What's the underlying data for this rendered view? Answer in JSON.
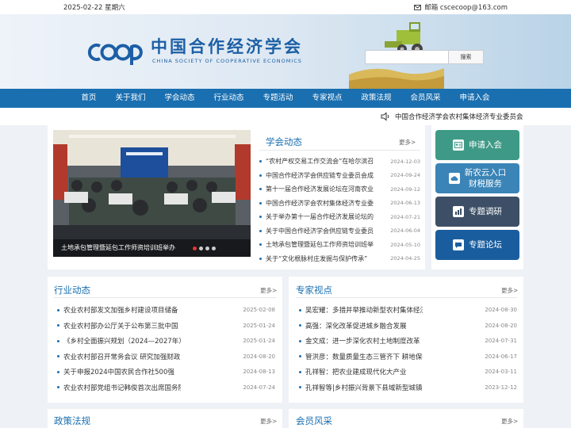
{
  "topbar": {
    "date": "2025-02-22 星期六",
    "email_label": "邮箱 cscecoop@163.com"
  },
  "banner": {
    "logo_text": "COOP",
    "title_cn": "中国合作经济学会",
    "title_en": "CHINA SOCIETY OF COOPERATIVE ECONOMICS",
    "search_placeholder": "",
    "search_button": "搜索"
  },
  "nav": [
    "首页",
    "关于我们",
    "学会动态",
    "行业动态",
    "专题活动",
    "专家视点",
    "政策法规",
    "会员风采",
    "申请入会"
  ],
  "notice": {
    "text": "中国合作经济学会农村集体经济专业委员会关于举办第十届合作经济发展论坛的通知"
  },
  "slide": {
    "caption": "土地承包管理暨延包工作师资培训班举办",
    "dots": 4
  },
  "society_news": {
    "title": "学会动态",
    "more": "更多>",
    "items": [
      {
        "title": "“农村产权交易工作交流会”在哈尔滨召开",
        "date": "2024-12-03"
      },
      {
        "title": "中国合作经济学会供应链专业委员会成立",
        "date": "2024-09-24"
      },
      {
        "title": "第十一届合作经济发展论坛在河南农业大学召开",
        "date": "2024-09-12"
      },
      {
        "title": "中国合作经济学会农村集体经济专业委员会",
        "date": "2024-06-13"
      },
      {
        "title": "关于举办第十一届合作经济发展论坛的通知",
        "date": "2024-07-21"
      },
      {
        "title": "关于中国合作经济学会供应链专业委员会",
        "date": "2024-06-04"
      },
      {
        "title": "土地承包管理暨延包工作师资培训班举办",
        "date": "2024-05-10"
      },
      {
        "title": "关于“文化根脉村庄发掘与保护传承”",
        "date": "2024-04-25"
      }
    ]
  },
  "tiles": [
    {
      "label": "申请入会",
      "color": "#3e9a87",
      "icon": "id-card-icon"
    },
    {
      "label": "新农云入口\n财税服务",
      "color": "#3a84b7",
      "icon": "cloud-icon"
    },
    {
      "label": "专题调研",
      "color": "#3c4f66",
      "icon": "chart-icon"
    },
    {
      "label": "专题论坛",
      "color": "#1a5d9e",
      "icon": "chat-icon"
    }
  ],
  "industry_news": {
    "title": "行业动态",
    "more": "更多>",
    "items": [
      {
        "title": "农业农村部发文加强乡村建设项目储备",
        "date": "2025-02-08"
      },
      {
        "title": "农业农村部办公厅关于公布第三批中国",
        "date": "2025-01-24"
      },
      {
        "title": "《乡村全面振兴规划（2024—2027年）》",
        "date": "2025-01-24"
      },
      {
        "title": "农业农村部召开常务会议 研究加强财政",
        "date": "2024-08-20"
      },
      {
        "title": "关于申报2024中国农民合作社500强",
        "date": "2024-08-13"
      },
      {
        "title": "农业农村部党组书记韩俊首次出席国务院",
        "date": "2024-07-24"
      }
    ]
  },
  "expert_views": {
    "title": "专家视点",
    "more": "更多>",
    "items": [
      {
        "title": "吴宏耀：多措并举推动新型农村集体经济",
        "date": "2024-08-30"
      },
      {
        "title": "高强：深化改革促进城乡融合发展",
        "date": "2024-08-20"
      },
      {
        "title": "金文成：进一步深化农村土地制度改革",
        "date": "2024-07-31"
      },
      {
        "title": "管洪彦：数量质量生态三管齐下 耕地保护",
        "date": "2024-06-17"
      },
      {
        "title": "孔祥智：把农业建成现代化大产业",
        "date": "2024-03-11"
      },
      {
        "title": "孔祥智等|乡村振兴背景下县域新型城镇化",
        "date": "2023-12-12"
      }
    ]
  },
  "policy": {
    "title": "政策法规",
    "more": "更多>"
  },
  "members": {
    "title": "会员风采",
    "more": "更多>"
  }
}
